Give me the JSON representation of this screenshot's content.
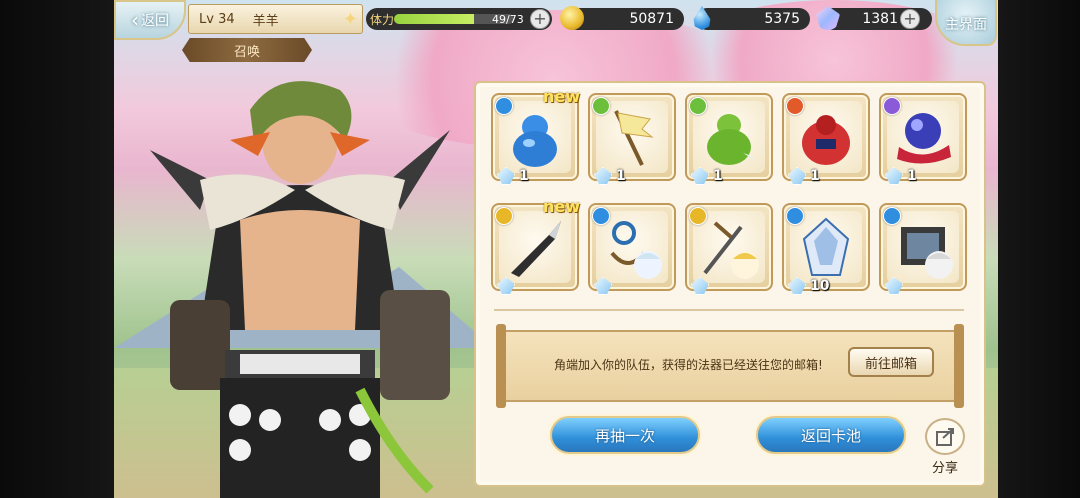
{
  "topbar": {
    "back_label": "返回",
    "level": "Lv 34",
    "player_name": "羊羊",
    "stamina_label": "体力",
    "stamina_value": "49/73",
    "stamina_fraction": 0.67,
    "gold": "50871",
    "water": "5375",
    "gems": "1381",
    "home_label": "主界面"
  },
  "summon_tag": "召唤",
  "rewards": [
    {
      "name": "blue-gourd",
      "new": "new",
      "count": "1",
      "element": "water"
    },
    {
      "name": "flag",
      "new": "",
      "count": "1",
      "element": "wind"
    },
    {
      "name": "green-gourd",
      "new": "",
      "count": "1",
      "element": "wind"
    },
    {
      "name": "red-pouch",
      "new": "",
      "count": "1",
      "element": "fire"
    },
    {
      "name": "dark-orb-scarf",
      "new": "",
      "count": "1",
      "element": "dark"
    },
    {
      "name": "dagger",
      "new": "new",
      "count": "",
      "element": "light"
    },
    {
      "name": "anchor-chain-character",
      "new": "",
      "count": "",
      "element": "water"
    },
    {
      "name": "sword-character",
      "new": "",
      "count": "",
      "element": "light"
    },
    {
      "name": "crystal-dragon",
      "new": "",
      "count": "10",
      "element": "water"
    },
    {
      "name": "shrine-character",
      "new": "",
      "count": "",
      "element": "water"
    }
  ],
  "message": "角端加入你的队伍，获得的法器已经送往您的邮箱!",
  "buttons": {
    "mail": "前往邮箱",
    "again": "再抽一次",
    "return_pool": "返回卡池",
    "share": "分享"
  },
  "colors": {
    "water": "#2f8ee0",
    "wind": "#6bbf3a",
    "fire": "#e2592a",
    "dark": "#8a5ad8",
    "light": "#e8b728"
  }
}
